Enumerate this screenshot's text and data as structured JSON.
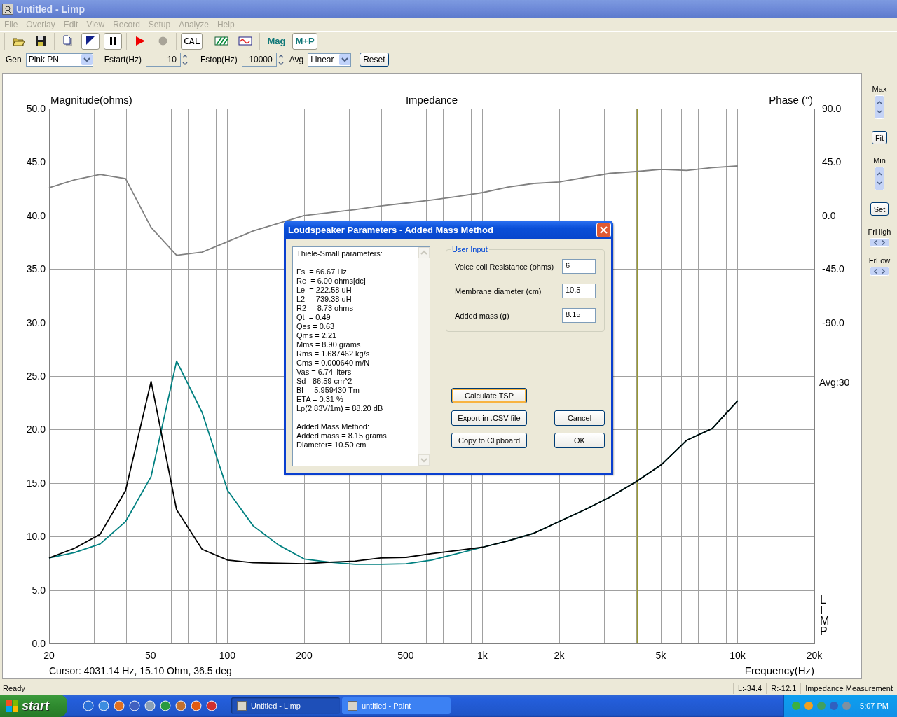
{
  "window": {
    "title": "Untitled - Limp"
  },
  "menu": [
    {
      "label": "File"
    },
    {
      "label": "Overlay"
    },
    {
      "label": "Edit"
    },
    {
      "label": "View"
    },
    {
      "label": "Record"
    },
    {
      "label": "Setup"
    },
    {
      "label": "Analyze"
    },
    {
      "label": "Help"
    }
  ],
  "toolbar": [
    [
      {
        "kind": "icon",
        "pressed": false
      },
      {
        "kind": "icon",
        "pressed": false
      }
    ],
    [
      {
        "kind": "icon",
        "pressed": false
      },
      {
        "kind": "icon",
        "pressed": true
      },
      {
        "kind": "icon",
        "pressed": true
      }
    ],
    [
      {
        "kind": "icon",
        "pressed": false
      },
      {
        "kind": "icon",
        "pressed": false
      }
    ],
    [
      {
        "kind": "text",
        "label": "CAL",
        "pressed": true
      }
    ],
    [
      {
        "kind": "icon",
        "pressed": false
      },
      {
        "kind": "icon",
        "pressed": false
      }
    ],
    [
      {
        "kind": "text",
        "label": "Mag",
        "pressed": false
      },
      {
        "kind": "text",
        "label": "M+P",
        "pressed": true
      }
    ]
  ],
  "params": {
    "gen": {
      "label": "Gen",
      "value": "Pink PN"
    },
    "fstart": {
      "label": "Fstart(Hz)",
      "value": "10"
    },
    "fstop": {
      "label": "Fstop(Hz)",
      "value": "10000"
    },
    "avg": {
      "label": "Avg",
      "value": "Linear"
    },
    "reset": "Reset"
  },
  "chart": {
    "x_axis_labels": [
      "20",
      "50",
      "100",
      "200",
      "500",
      "1k",
      "2k",
      "5k",
      "10k",
      "20k"
    ],
    "cursor_text": "Cursor: 4031.14 Hz, 15.10 Ohm, 36.5 deg",
    "avg_text": "Avg:30",
    "logo": "LIMP",
    "chart_data": {
      "type": "line",
      "title": "Impedance",
      "xlabel": "Frequency(Hz)",
      "ylabel": "Magnitude(ohms)",
      "y2label": "Phase (°)",
      "grid": true,
      "ylim": [
        0,
        50
      ],
      "y2lim": [
        -360,
        90
      ],
      "y2ticks": [
        {
          "value": 90,
          "label": "90.0"
        },
        {
          "value": 45,
          "label": "45.0"
        },
        {
          "value": 0,
          "label": "0.0"
        },
        {
          "value": -45,
          "label": "-45.0"
        },
        {
          "value": -90,
          "label": "-90.0"
        }
      ],
      "yticks": [
        {
          "value": 0,
          "label": "0.0"
        },
        {
          "value": 5,
          "label": "5.0"
        },
        {
          "value": 10,
          "label": "10.0"
        },
        {
          "value": 15,
          "label": "15.0"
        },
        {
          "value": 20,
          "label": "20.0"
        },
        {
          "value": 25,
          "label": "25.0"
        },
        {
          "value": 30,
          "label": "30.0"
        },
        {
          "value": 35,
          "label": "35.0"
        },
        {
          "value": 40,
          "label": "40.0"
        },
        {
          "value": 45,
          "label": "45.0"
        },
        {
          "value": 50,
          "label": "50.0"
        }
      ],
      "categories": [
        null,
        null,
        null,
        null,
        null,
        null,
        null,
        null,
        null,
        null,
        null,
        null,
        null,
        null,
        null,
        null,
        null,
        null,
        null,
        null,
        null,
        null,
        null,
        null,
        null,
        null,
        null,
        null
      ],
      "series": [
        {
          "color": "#000000",
          "values": [
            8.0,
            8.9,
            10.2,
            14.3,
            24.5,
            12.5,
            8.8,
            7.8,
            7.55,
            7.5,
            7.45,
            7.6,
            7.7,
            8.0,
            8.05,
            8.4,
            8.7,
            9.0,
            9.6,
            10.3,
            11.4,
            12.5,
            13.7,
            15.1,
            16.7,
            19.0,
            20.1,
            22.7
          ]
        },
        {
          "color": "#008080",
          "values": [
            8.0,
            8.5,
            9.3,
            11.4,
            15.6,
            26.4,
            21.6,
            14.3,
            11.0,
            9.2,
            7.9,
            7.6,
            7.4,
            7.4,
            7.45,
            7.8,
            8.4,
            9.0,
            9.6,
            10.3,
            11.4,
            12.5,
            13.7,
            15.1,
            16.7,
            19.0,
            20.1,
            22.7
          ]
        },
        {
          "color": "#808080",
          "axis": "y2",
          "values": [
            23.4,
            30.0,
            34.5,
            31.0,
            -10.0,
            -33.5,
            -30.8,
            -22.0,
            -13.0,
            -6.5,
            0.0,
            2.5,
            5.0,
            8.0,
            10.5,
            13.0,
            16.0,
            19.3,
            24.0,
            27.0,
            28.2,
            32.0,
            35.5,
            37.0,
            38.8,
            38.0,
            40.3,
            41.7
          ]
        }
      ]
    }
  },
  "side_panel": [
    {
      "kind": "label",
      "text": "Max"
    },
    {
      "kind": "vspin"
    },
    {
      "kind": "button",
      "text": "Fit"
    },
    {
      "kind": "label",
      "text": "Min"
    },
    {
      "kind": "vspin"
    },
    {
      "kind": "button",
      "text": "Set"
    },
    {
      "kind": "label",
      "text": "FrHigh"
    },
    {
      "kind": "hspin"
    },
    {
      "kind": "label",
      "text": "FrLow"
    },
    {
      "kind": "hspin"
    }
  ],
  "dialog": {
    "title": "Loudspeaker Parameters - Added Mass Method",
    "text_groups": [
      [
        "Thiele-Small parameters:"
      ],
      [
        "Fs  = 66.67 Hz",
        "Re  = 6.00 ohms[dc]",
        "Le  = 222.58 uH",
        "L2  = 739.38 uH",
        "R2  = 8.73 ohms",
        "Qt  = 0.49",
        "Qes = 0.63",
        "Qms = 2.21",
        "Mms = 8.90 grams",
        "Rms = 1.687462 kg/s",
        "Cms = 0.000640 m/N",
        "Vas = 6.74 liters",
        "Sd= 86.59 cm^2",
        "Bl  = 5.959430 Tm",
        "ETA = 0.31 %",
        "Lp(2.83V/1m) = 88.20 dB"
      ],
      [
        "Added Mass Method:",
        "Added mass = 8.15 grams",
        "Diameter= 10.50 cm"
      ]
    ],
    "group_title": "User Input",
    "fields": [
      {
        "label": "Voice coil Resistance (ohms)",
        "value": "6"
      },
      {
        "label": "Membrane diameter (cm)",
        "value": "10.5"
      },
      {
        "label": "Added mass (g)",
        "value": "8.15"
      }
    ],
    "buttons": [
      {
        "label": "Calculate TSP",
        "focused": true
      },
      {
        "label": "Export in .CSV file",
        "focused": false
      },
      {
        "label": "Cancel",
        "focused": false
      },
      {
        "label": "Copy to Clipboard",
        "focused": false
      },
      {
        "label": "OK",
        "focused": false
      }
    ]
  },
  "status_bar": [
    "Ready",
    "L:-34.4",
    "R:-12.1",
    "Impedance Measurement"
  ],
  "taskbar": {
    "start": "start",
    "quick_launch": [
      {
        "color": "#2a6fd6"
      },
      {
        "color": "#3c8de0"
      },
      {
        "color": "#e07020"
      },
      {
        "color": "#4060c0"
      },
      {
        "color": "#8aa0b8"
      },
      {
        "color": "#2a9a40"
      },
      {
        "color": "#c07030"
      },
      {
        "color": "#e05a10"
      },
      {
        "color": "#d03030"
      }
    ],
    "tasks": [
      {
        "label": "Untitled - Limp",
        "selected": true
      },
      {
        "label": "untitled - Paint",
        "selected": false
      }
    ],
    "tray": [
      {
        "color": "#3cb040"
      },
      {
        "color": "#f0a020"
      },
      {
        "color": "#40a060"
      },
      {
        "color": "#3060c0"
      },
      {
        "color": "#8090a0"
      }
    ],
    "clock": "5:07 PM"
  }
}
